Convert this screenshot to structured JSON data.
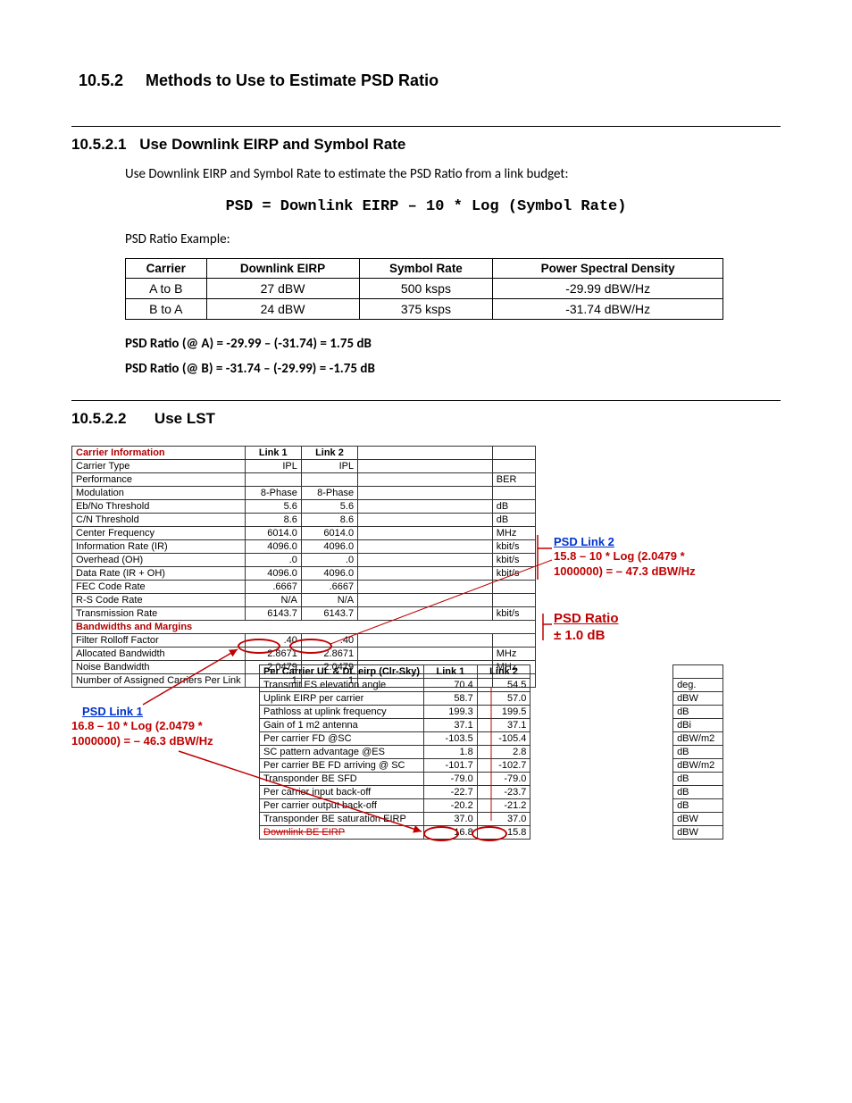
{
  "sec_10_5_2": {
    "num": "10.5.2",
    "title": "Methods to Use to Estimate PSD Ratio"
  },
  "sec_10_5_2_1": {
    "num": "10.5.2.1",
    "title": "Use Downlink EIRP and Symbol Rate",
    "intro": "Use Downlink EIRP and Symbol Rate to estimate the PSD Ratio from a link budget:",
    "formula": "PSD = Downlink EIRP – 10 * Log (Symbol Rate)",
    "example_label": "PSD Ratio Example:",
    "table": {
      "headers": [
        "Carrier",
        "Downlink EIRP",
        "Symbol Rate",
        "Power Spectral Density"
      ],
      "rows": [
        [
          "A to B",
          "27 dBW",
          "500 ksps",
          "-29.99 dBW/Hz"
        ],
        [
          "B to A",
          "24 dBW",
          "375 ksps",
          "-31.74 dBW/Hz"
        ]
      ]
    },
    "calc_a": "PSD Ratio (@ A) = -29.99 – (-31.74) = 1.75 dB",
    "calc_b": "PSD Ratio (@ B) = -31.74 – (-29.99) = -1.75 dB"
  },
  "sec_10_5_2_2": {
    "num": "10.5.2.2",
    "title": "Use LST"
  },
  "lst": {
    "sections": {
      "carrier_info": "Carrier Information",
      "bandwidths": "Bandwidths and Margins",
      "per_carrier": "Per Carrier UL & DL eirp (Clr-Sky)"
    },
    "cols": {
      "l1": "Link 1",
      "l2": "Link 2"
    },
    "rows1": [
      {
        "label": "Carrier Type",
        "l1": "IPL",
        "l2": "IPL",
        "unit": ""
      },
      {
        "label": "Performance",
        "l1": "",
        "l2": "",
        "unit": "BER"
      },
      {
        "label": "Modulation",
        "l1": "8-Phase",
        "l2": "8-Phase",
        "unit": ""
      },
      {
        "label": "Eb/No Threshold",
        "l1": "5.6",
        "l2": "5.6",
        "unit": "dB"
      },
      {
        "label": "C/N Threshold",
        "l1": "8.6",
        "l2": "8.6",
        "unit": "dB"
      },
      {
        "label": "Center Frequency",
        "l1": "6014.0",
        "l2": "6014.0",
        "unit": "MHz"
      },
      {
        "label": "Information Rate (IR)",
        "l1": "4096.0",
        "l2": "4096.0",
        "unit": "kbit/s"
      },
      {
        "label": "Overhead (OH)",
        "l1": ".0",
        "l2": ".0",
        "unit": "kbit/s"
      },
      {
        "label": "Data Rate (IR + OH)",
        "l1": "4096.0",
        "l2": "4096.0",
        "unit": "kbit/s"
      },
      {
        "label": "FEC Code Rate",
        "l1": ".6667",
        "l2": ".6667",
        "unit": ""
      },
      {
        "label": "R-S Code Rate",
        "l1": "N/A",
        "l2": "N/A",
        "unit": ""
      },
      {
        "label": "Transmission Rate",
        "l1": "6143.7",
        "l2": "6143.7",
        "unit": "kbit/s"
      }
    ],
    "rows2": [
      {
        "label": "Filter Rolloff Factor",
        "l1": ".40",
        "l2": ".40",
        "unit": ""
      },
      {
        "label": "Allocated Bandwidth",
        "l1": "2.8671",
        "l2": "2.8671",
        "unit": "MHz"
      },
      {
        "label": "Noise Bandwidth",
        "l1": "2.0479",
        "l2": "2.0479",
        "unit": "MHz"
      },
      {
        "label": "Number of Assigned Carriers Per Link",
        "l1": "1",
        "l2": "1",
        "unit": ""
      }
    ],
    "rows3": [
      {
        "label": "Transmit ES elevation angle",
        "l1": "70.4",
        "l2": "54.5",
        "unit": "deg."
      },
      {
        "label": "Uplink EIRP per carrier",
        "l1": "58.7",
        "l2": "57.0",
        "unit": "dBW"
      },
      {
        "label": "Pathloss at uplink frequency",
        "l1": "199.3",
        "l2": "199.5",
        "unit": "dB"
      },
      {
        "label": "Gain of 1 m2 antenna",
        "l1": "37.1",
        "l2": "37.1",
        "unit": "dBi"
      },
      {
        "label": "Per carrier FD @SC",
        "l1": "-103.5",
        "l2": "-105.4",
        "unit": "dBW/m2"
      },
      {
        "label": "SC pattern advantage @ES",
        "l1": "1.8",
        "l2": "2.8",
        "unit": "dB"
      },
      {
        "label": "Per carrier BE FD arriving @ SC",
        "l1": "-101.7",
        "l2": "-102.7",
        "unit": "dBW/m2"
      },
      {
        "label": "Transponder BE SFD",
        "l1": "-79.0",
        "l2": "-79.0",
        "unit": "dB"
      },
      {
        "label": "Per carrier input back-off",
        "l1": "-22.7",
        "l2": "-23.7",
        "unit": "dB"
      },
      {
        "label": "Per carrier output back-off",
        "l1": "-20.2",
        "l2": "-21.2",
        "unit": "dB"
      },
      {
        "label": "Transponder BE saturation EIRP",
        "l1": "37.0",
        "l2": "37.0",
        "unit": "dBW"
      },
      {
        "label": "Downlink BE EIRP",
        "l1": "16.8",
        "l2": "15.8",
        "unit": "dBW"
      }
    ]
  },
  "annot": {
    "psd_link1_title": "PSD Link 1",
    "psd_link1_calc": "16.8 – 10 * Log (2.0479 * 1000000) =  – 46.3 dBW/Hz",
    "psd_link2_title": "PSD Link 2",
    "psd_link2_calc": "15.8 – 10 * Log (2.0479 * 1000000) =  – 47.3 dBW/Hz",
    "psd_ratio_title": "PSD Ratio",
    "psd_ratio_val": "± 1.0 dB"
  }
}
